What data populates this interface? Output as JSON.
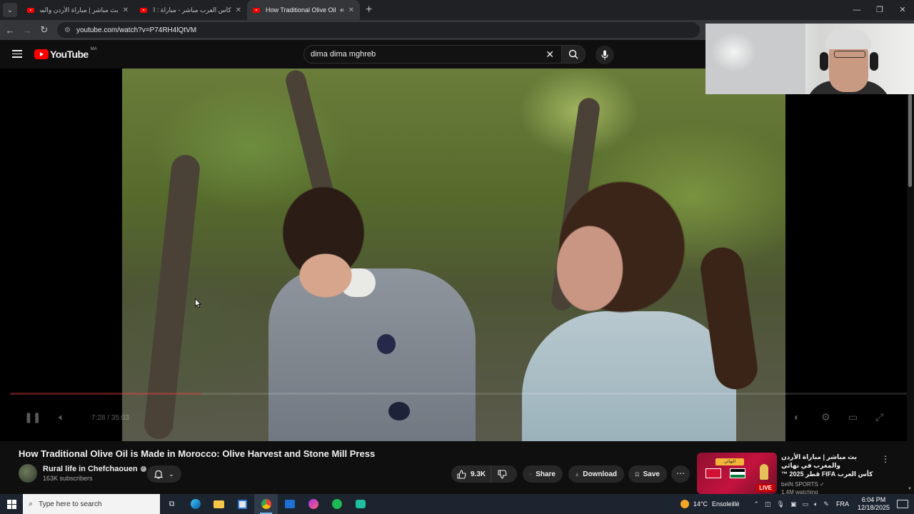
{
  "browser": {
    "tabs": [
      {
        "title": "بث مباشر | مباراة الأردن والمغرب",
        "active": false,
        "audio": false
      },
      {
        "title": "كأس العرب مباشر - مباراة : السعو",
        "active": false,
        "audio": false
      },
      {
        "title": "How Traditional Olive Oil is",
        "active": true,
        "audio": true
      }
    ],
    "url": "youtube.com/watch?v=P74RH4lQtVM"
  },
  "youtube": {
    "country_code": "MA",
    "logo_text": "YouTube",
    "search_query": "dima dima mghreb"
  },
  "player": {
    "timecode": "7:28 / 35:03",
    "progress_fraction": 0.213
  },
  "video": {
    "title": "How Traditional Olive Oil is Made in Morocco: Olive Harvest and Stone Mill Press",
    "channel": "Rural life in Chefchaouen",
    "subscribers": "163K subscribers",
    "likes": "9.3K",
    "share_label": "Share",
    "download_label": "Download",
    "save_label": "Save"
  },
  "recommendation": {
    "title_line1": "بث مباشر | مباراة الأردن والمغرب في نهائي",
    "title_line2": "كأس العرب FIFA قطر 2025 ™",
    "channel": "beIN SPORTS",
    "views": "1.4M watching",
    "badge": "LIVE",
    "thumb_banner": "النهائي"
  },
  "taskbar": {
    "search_placeholder": "Type here to search",
    "weather_temp": "14°C",
    "weather_desc": "Ensoleillé",
    "language": "FRA",
    "time": "6:04 PM",
    "date": "12/18/2025"
  },
  "colors": {
    "youtube_red": "#ff0000",
    "background": "#0f0f0f",
    "pill": "#272727",
    "taskbar": "#1c2430"
  }
}
